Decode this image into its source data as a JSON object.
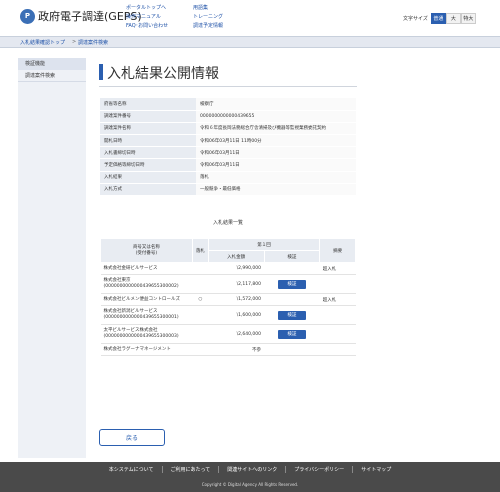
{
  "header": {
    "logo_mark": "P",
    "logo_text": "政府電子調達(GEPS)",
    "links_col1": [
      "ポータルトップへ",
      "操作マニュアル",
      "FAQ･お問い合わせ"
    ],
    "links_col2": [
      "用語集",
      "トレーニング",
      "調達予定情報"
    ],
    "font_size_label": "文字サイズ",
    "font_sizes": [
      "普通",
      "大",
      "特大"
    ]
  },
  "breadcrumb": {
    "items": [
      "入札結果確認トップ",
      "調達案件検索"
    ],
    "separator": ">"
  },
  "sidebar": {
    "items": [
      "検証機能",
      "調達案件検索"
    ]
  },
  "page": {
    "title": "入札結果公開情報"
  },
  "details": [
    {
      "label": "府省等名称",
      "value": "検察庁"
    },
    {
      "label": "調達案件番号",
      "value": "0000000000000439655"
    },
    {
      "label": "調達案件名称",
      "value": "令和６年度長岡法務総合庁舎清掃及び機器等監視業務委託契約"
    },
    {
      "label": "開札日時",
      "value": "令和06年03月11日 11時00分"
    },
    {
      "label": "入札書締切日時",
      "value": "令和06年03月11日"
    },
    {
      "label": "予定価格等締切日時",
      "value": "令和06年03月11日"
    },
    {
      "label": "入札結果",
      "value": "落札"
    },
    {
      "label": "入札方式",
      "value": "一般競争・最低価格"
    }
  ],
  "results": {
    "caption": "入札結果一覧",
    "headers": {
      "company": "商号又は名称\n(受付番号)",
      "winner": "落札",
      "round": "第１回",
      "amount": "入札金額",
      "verify": "検証",
      "remarks": "摘要"
    },
    "verify_label": "検証",
    "rows": [
      {
        "name": "株式会社金研ビルサービス",
        "reg": "",
        "winner": "",
        "amount": "\\2,990,000",
        "verify": false,
        "remarks": "超入札"
      },
      {
        "name": "株式会社東京",
        "reg": "(0000000000000439655300002)",
        "winner": "",
        "amount": "\\2,117,800",
        "verify": true,
        "remarks": ""
      },
      {
        "name": "株式会社ビルメン便益コントロールズ",
        "reg": "",
        "winner": "○",
        "amount": "\\1,572,000",
        "verify": false,
        "remarks": "超入札"
      },
      {
        "name": "株式会社新潟ビルサービス",
        "reg": "(0000000000000439655300001)",
        "winner": "",
        "amount": "\\1,600,000",
        "verify": true,
        "remarks": ""
      },
      {
        "name": "太平ビルサービス株式会社",
        "reg": "(0000000000000439655300003)",
        "winner": "",
        "amount": "\\2,640,000",
        "verify": true,
        "remarks": ""
      },
      {
        "name": "株式会社ラグーナマネージメント",
        "reg": "",
        "winner": "",
        "amount": "不参",
        "verify": false,
        "remarks": ""
      }
    ]
  },
  "back_label": "戻る",
  "footer": {
    "links": [
      "本システムについて",
      "ご利用にあたって",
      "関連サイトへのリンク",
      "プライバシーポリシー",
      "サイトマップ"
    ],
    "copyright": "Copyright © Digital Agency All Rights Reserved."
  }
}
